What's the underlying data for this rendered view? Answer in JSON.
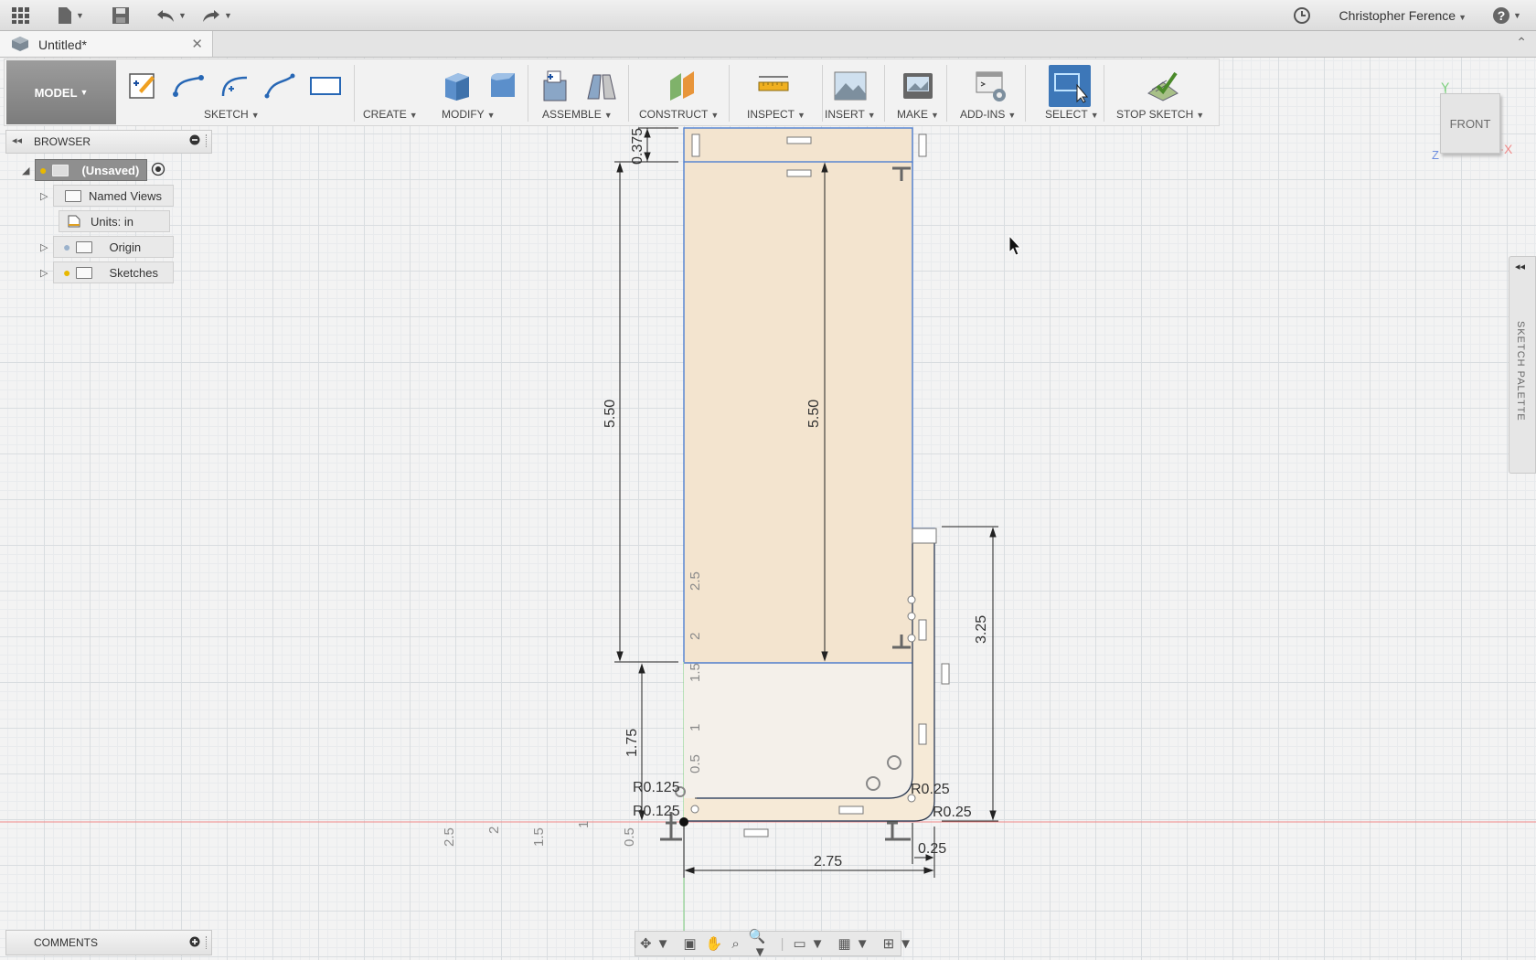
{
  "titlebar": {
    "user": "Christopher Ference",
    "help": "?"
  },
  "tab": {
    "title": "Untitled*",
    "close": "✕"
  },
  "toolbar": {
    "model_label": "MODEL",
    "groups": {
      "sketch": "SKETCH",
      "create": "CREATE",
      "modify": "MODIFY",
      "assemble": "ASSEMBLE",
      "construct": "CONSTRUCT",
      "inspect": "INSPECT",
      "insert": "INSERT",
      "make": "MAKE",
      "addins": "ADD-INS",
      "select": "SELECT",
      "stop_sketch": "STOP SKETCH"
    }
  },
  "browser": {
    "title": "BROWSER",
    "root": "(Unsaved)",
    "items": [
      "Named Views",
      "Units: in",
      "Origin",
      "Sketches"
    ]
  },
  "comments": {
    "title": "COMMENTS"
  },
  "viewcube": {
    "face": "FRONT",
    "axis_x": "X",
    "axis_y": "Y",
    "axis_z": "Z"
  },
  "palette": {
    "title": "SKETCH PALETTE"
  },
  "sketch": {
    "dims": {
      "top_height": "0.375",
      "left_height": "5.50",
      "inner_height": "5.50",
      "lower_height": "1.75",
      "right_height": "3.25",
      "width": "2.75",
      "thickness": "0.25",
      "radius_outer_right": "R0.25",
      "radius_inner_right": "R0.25",
      "radius_left_a": "R0.125",
      "radius_left_b": "R0.125"
    },
    "ruler_vertical": [
      "2.5",
      "2",
      "1.5",
      "1",
      "0.5"
    ],
    "ruler_horizontal": [
      "2.5",
      "2",
      "1.5",
      "1",
      "0.5"
    ]
  }
}
